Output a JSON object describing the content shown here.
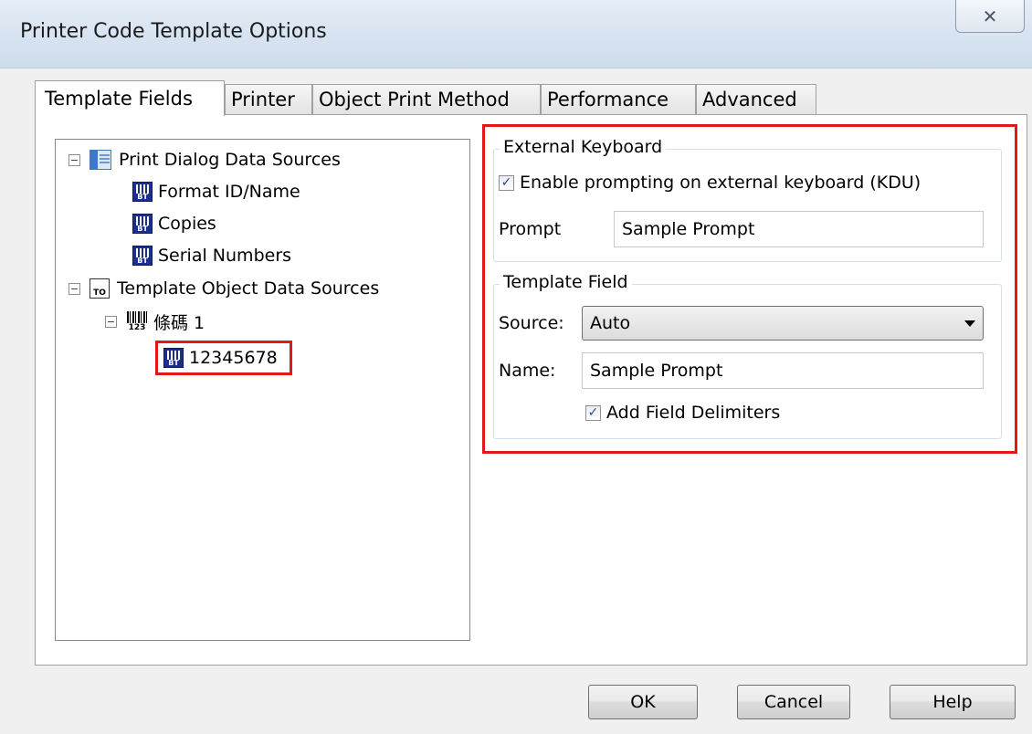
{
  "window": {
    "title": "Printer Code Template Options",
    "close_glyph": "✕"
  },
  "tabs": [
    {
      "label": "Template Fields",
      "active": true
    },
    {
      "label": "Printer"
    },
    {
      "label": "Object Print Method"
    },
    {
      "label": "Performance"
    },
    {
      "label": "Advanced"
    }
  ],
  "tree": {
    "expander_glyph": "−",
    "print_dialog": {
      "label": "Print Dialog Data Sources",
      "children": [
        "Format ID/Name",
        "Copies",
        "Serial Numbers"
      ]
    },
    "template_object": {
      "label": "Template Object Data Sources",
      "barcode": {
        "label": "條碼 1",
        "children": [
          "12345678"
        ]
      }
    },
    "icon_text_bt": "BT",
    "icon_text_to": "TO",
    "icon_text_barcode": "123"
  },
  "external_keyboard": {
    "title": "External Keyboard",
    "enable_label": "Enable prompting on external keyboard (KDU)",
    "enable_checked": true,
    "prompt_label": "Prompt",
    "prompt_value": "Sample Prompt"
  },
  "template_field": {
    "title": "Template Field",
    "source_label": "Source:",
    "source_value": "Auto",
    "name_label": "Name:",
    "name_value": "Sample Prompt",
    "delimiters_label": "Add Field Delimiters",
    "delimiters_checked": true
  },
  "check_glyph": "✓",
  "buttons": {
    "ok": "OK",
    "cancel": "Cancel",
    "help": "Help"
  },
  "colors": {
    "highlight_red": "#e01818",
    "icon_blue": "#1c2f8f"
  }
}
